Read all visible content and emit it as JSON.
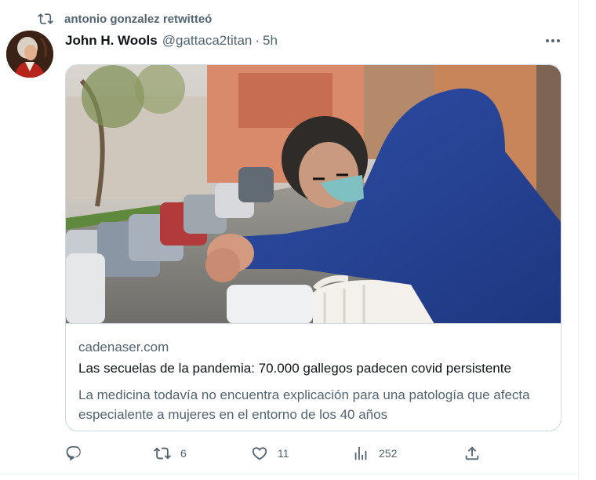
{
  "retweet": {
    "icon": "retweet-icon",
    "text": "antonio gonzalez retwitteó"
  },
  "author": {
    "name": "John H. Wools",
    "handle": "@gattaca2titan",
    "separator": "·",
    "time": "5h"
  },
  "card": {
    "domain": "cadenaser.com",
    "title": "Las secuelas de la pandemia: 70.000 gallegos padecen covid persistente",
    "description": "La medicina todavía no encuentra explicación para una patología que afecta especialente a mujeres en el entorno de los 40 años"
  },
  "actions": {
    "reply": {
      "icon": "reply-icon"
    },
    "retweet": {
      "icon": "retweet-icon",
      "count": "6"
    },
    "like": {
      "icon": "heart-icon",
      "count": "11"
    },
    "views": {
      "icon": "views-icon",
      "count": "252"
    },
    "share": {
      "icon": "share-icon"
    }
  },
  "colors": {
    "text_primary": "#0f1419",
    "text_secondary": "#536471",
    "border": "#cfd9de"
  }
}
